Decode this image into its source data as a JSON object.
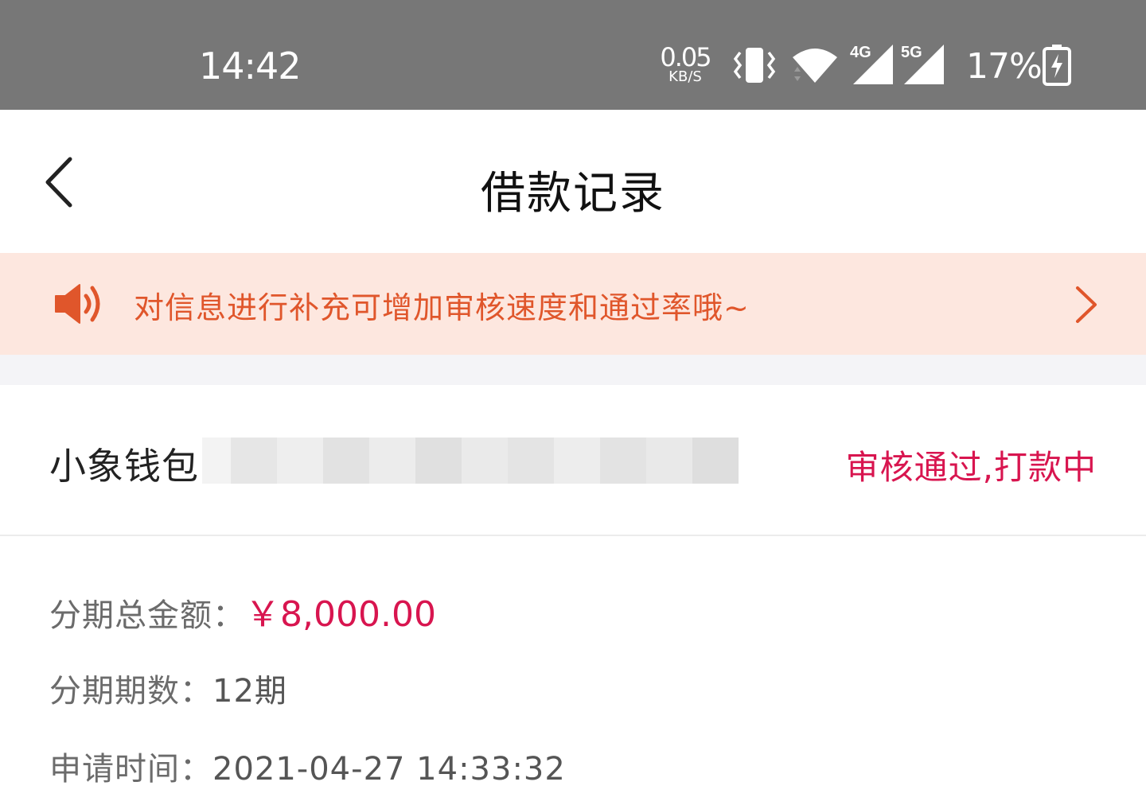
{
  "status_bar": {
    "time": "14:42",
    "net_speed_value": "0.05",
    "net_speed_unit": "KB/S",
    "signal_1_label": "4G",
    "signal_2_label": "5G",
    "battery_percent": "17%",
    "icons": [
      "vibrate-icon",
      "wifi-icon",
      "signal-4g-icon",
      "signal-5g-icon",
      "battery-charging-icon"
    ]
  },
  "nav": {
    "title": "借款记录",
    "back_icon": "chevron-left-icon"
  },
  "notice": {
    "text": "对信息进行补充可增加审核速度和通过率哦~",
    "icon": "speaker-icon",
    "chevron_icon": "chevron-right-icon",
    "color": "#e0562b",
    "background": "#fde7df"
  },
  "record": {
    "name": "小象钱包",
    "status": "审核通过,打款中",
    "status_color": "#d8154f",
    "fields": [
      {
        "label": "分期总金额：",
        "value": "￥8,000.00"
      },
      {
        "label": "分期期数：",
        "value": "12期"
      },
      {
        "label": "申请时间：",
        "value": "2021-04-27 14:33:32"
      }
    ]
  }
}
